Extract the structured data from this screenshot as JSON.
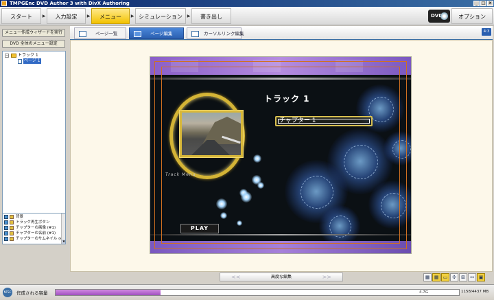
{
  "window": {
    "title": "TMPGEnc DVD Author 3 with DivX Authoring"
  },
  "steps": [
    {
      "label": "スタート"
    },
    {
      "label": "入力設定"
    },
    {
      "label": "メニュー"
    },
    {
      "label": "シミュレーション"
    },
    {
      "label": "書き出し"
    }
  ],
  "header": {
    "dvd_logo": "DVD",
    "options_label": "オプション"
  },
  "left": {
    "wizard_button": "メニュー作成ウィザードを実行",
    "dvd_menu_button": "DVD 全体のメニュー設定",
    "tree": {
      "root": "トラック 1",
      "child": "ページ 1"
    },
    "layers": [
      "背景",
      "トラック再生ボタン",
      "チャプターの画像 (#1)",
      "チャプターの名前 (#1)",
      "チャプターのサムネイル (#1)"
    ]
  },
  "tabs": [
    {
      "label": "ページ一覧"
    },
    {
      "label": "ページ編集"
    },
    {
      "label": "カーソルリンク編集"
    }
  ],
  "aspect_badge": "4:3",
  "menu": {
    "track_title": "トラック 1",
    "chapter_label": "チャプター 1",
    "track_menu_text": "Track Menu",
    "play_label": "PLAY"
  },
  "nav": {
    "prev": "<<",
    "center": "高度な編集",
    "next": ">>"
  },
  "status": {
    "ntsc": "NTSC",
    "capacity_label": "作成される容量",
    "capacity_used_mb": 1158,
    "capacity_total_mb": 4437,
    "capacity_mark": "4.7G",
    "capacity_text": "1158/4437 MB"
  }
}
